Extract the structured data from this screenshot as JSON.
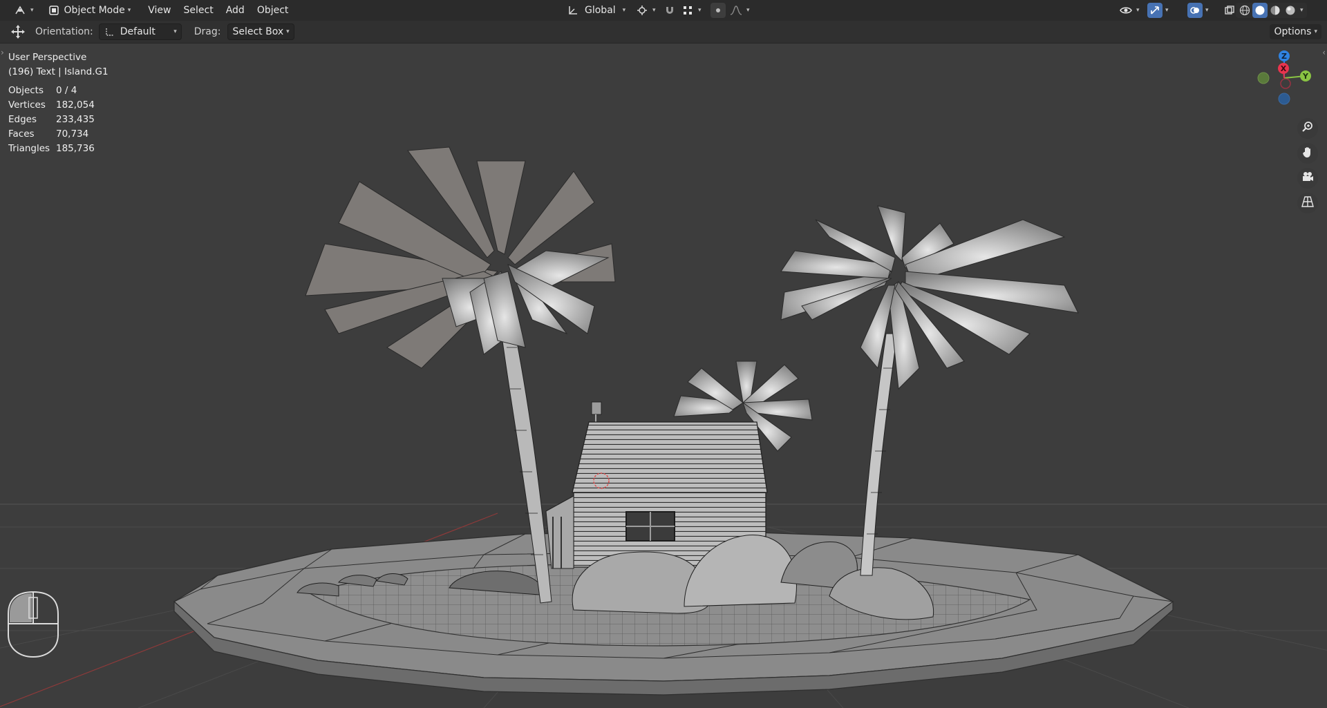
{
  "header": {
    "mode": "Object Mode",
    "menus": [
      "View",
      "Select",
      "Add",
      "Object"
    ],
    "transform_orientation": "Global"
  },
  "toolbar": {
    "orientation_label": "Orientation:",
    "orientation_value": "Default",
    "drag_label": "Drag:",
    "drag_value": "Select Box",
    "options_label": "Options"
  },
  "viewport": {
    "perspective": "User Perspective",
    "object_info": "(196) Text | Island.G1",
    "stats": [
      {
        "key": "Objects",
        "value": "0 / 4"
      },
      {
        "key": "Vertices",
        "value": "182,054"
      },
      {
        "key": "Edges",
        "value": "233,435"
      },
      {
        "key": "Faces",
        "value": "70,734"
      },
      {
        "key": "Triangles",
        "value": "185,736"
      }
    ]
  },
  "gizmo": {
    "z": "Z",
    "x": "X",
    "y": "Y"
  },
  "colors": {
    "header_bg": "#2b2b2b",
    "toolbar_bg": "#303030",
    "viewport_bg": "#3d3d3d",
    "accent": "#4772b3",
    "axis_x": "#e9344e",
    "axis_y": "#8ac443",
    "axis_z": "#2f83e3"
  }
}
